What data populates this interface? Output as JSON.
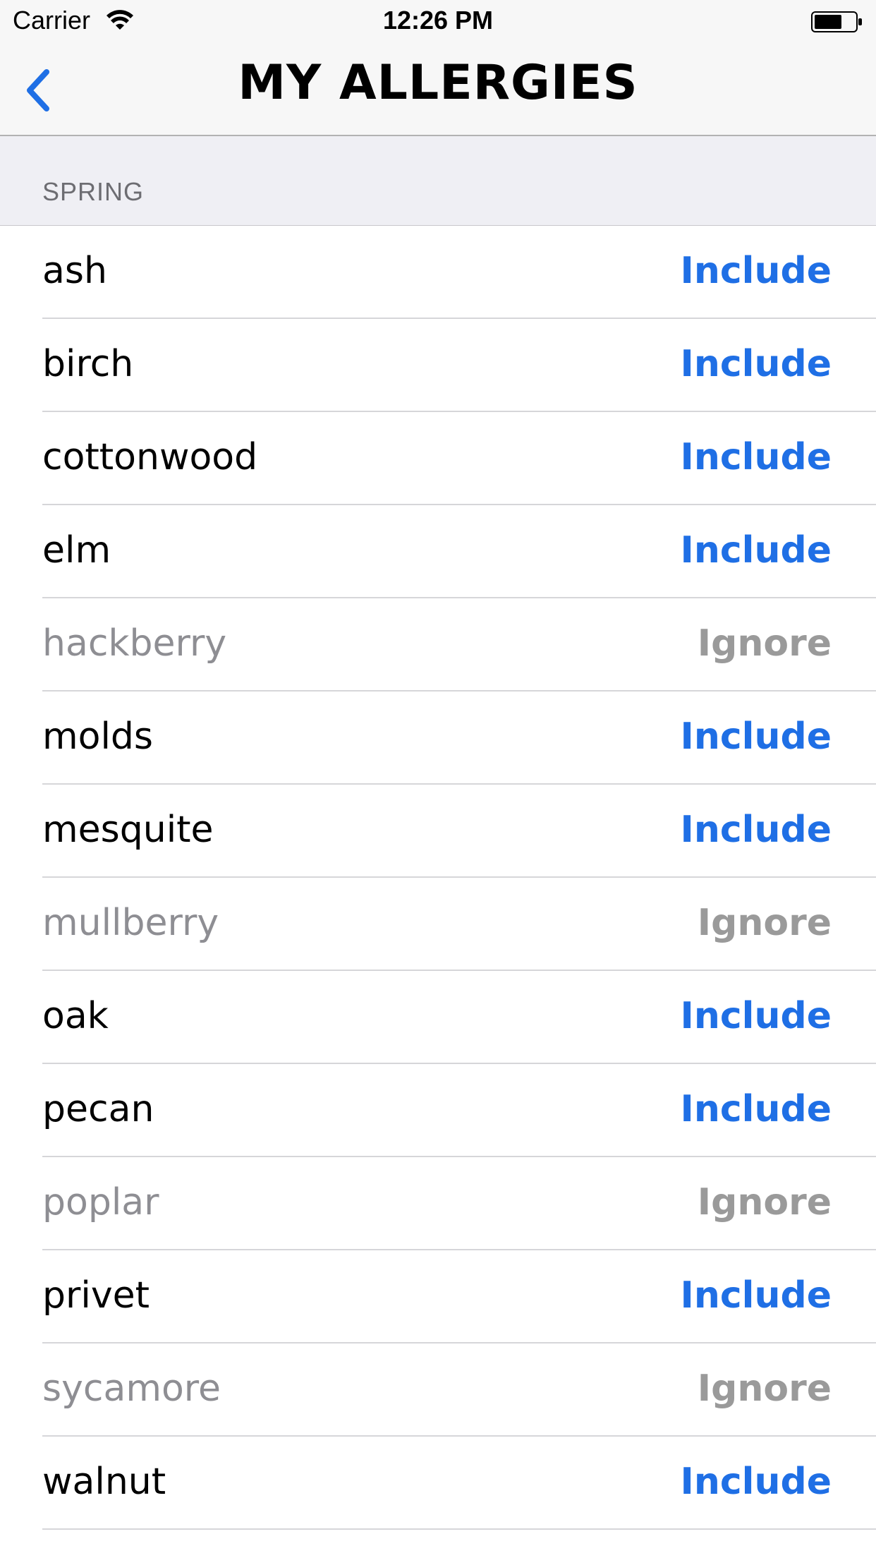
{
  "status_bar": {
    "carrier": "Carrier",
    "time": "12:26 PM",
    "wifi_icon": "wifi-icon",
    "battery_icon": "battery-icon"
  },
  "nav": {
    "title": "MY ALLERGIES",
    "back_icon": "chevron-left-icon"
  },
  "section": {
    "title": "SPRING"
  },
  "colors": {
    "include": "#1f6fe5",
    "ignore": "#9a9a9a",
    "name_active": "#000000",
    "name_ignored": "#8e8e93"
  },
  "allergens": [
    {
      "name": "ash",
      "action": "Include",
      "state": "include"
    },
    {
      "name": "birch",
      "action": "Include",
      "state": "include"
    },
    {
      "name": "cottonwood",
      "action": "Include",
      "state": "include"
    },
    {
      "name": "elm",
      "action": "Include",
      "state": "include"
    },
    {
      "name": "hackberry",
      "action": "Ignore",
      "state": "ignore"
    },
    {
      "name": "molds",
      "action": "Include",
      "state": "include"
    },
    {
      "name": "mesquite",
      "action": "Include",
      "state": "include"
    },
    {
      "name": "mullberry",
      "action": "Ignore",
      "state": "ignore"
    },
    {
      "name": "oak",
      "action": "Include",
      "state": "include"
    },
    {
      "name": "pecan",
      "action": "Include",
      "state": "include"
    },
    {
      "name": "poplar",
      "action": "Ignore",
      "state": "ignore"
    },
    {
      "name": "privet",
      "action": "Include",
      "state": "include"
    },
    {
      "name": "sycamore",
      "action": "Ignore",
      "state": "ignore"
    },
    {
      "name": "walnut",
      "action": "Include",
      "state": "include"
    }
  ]
}
